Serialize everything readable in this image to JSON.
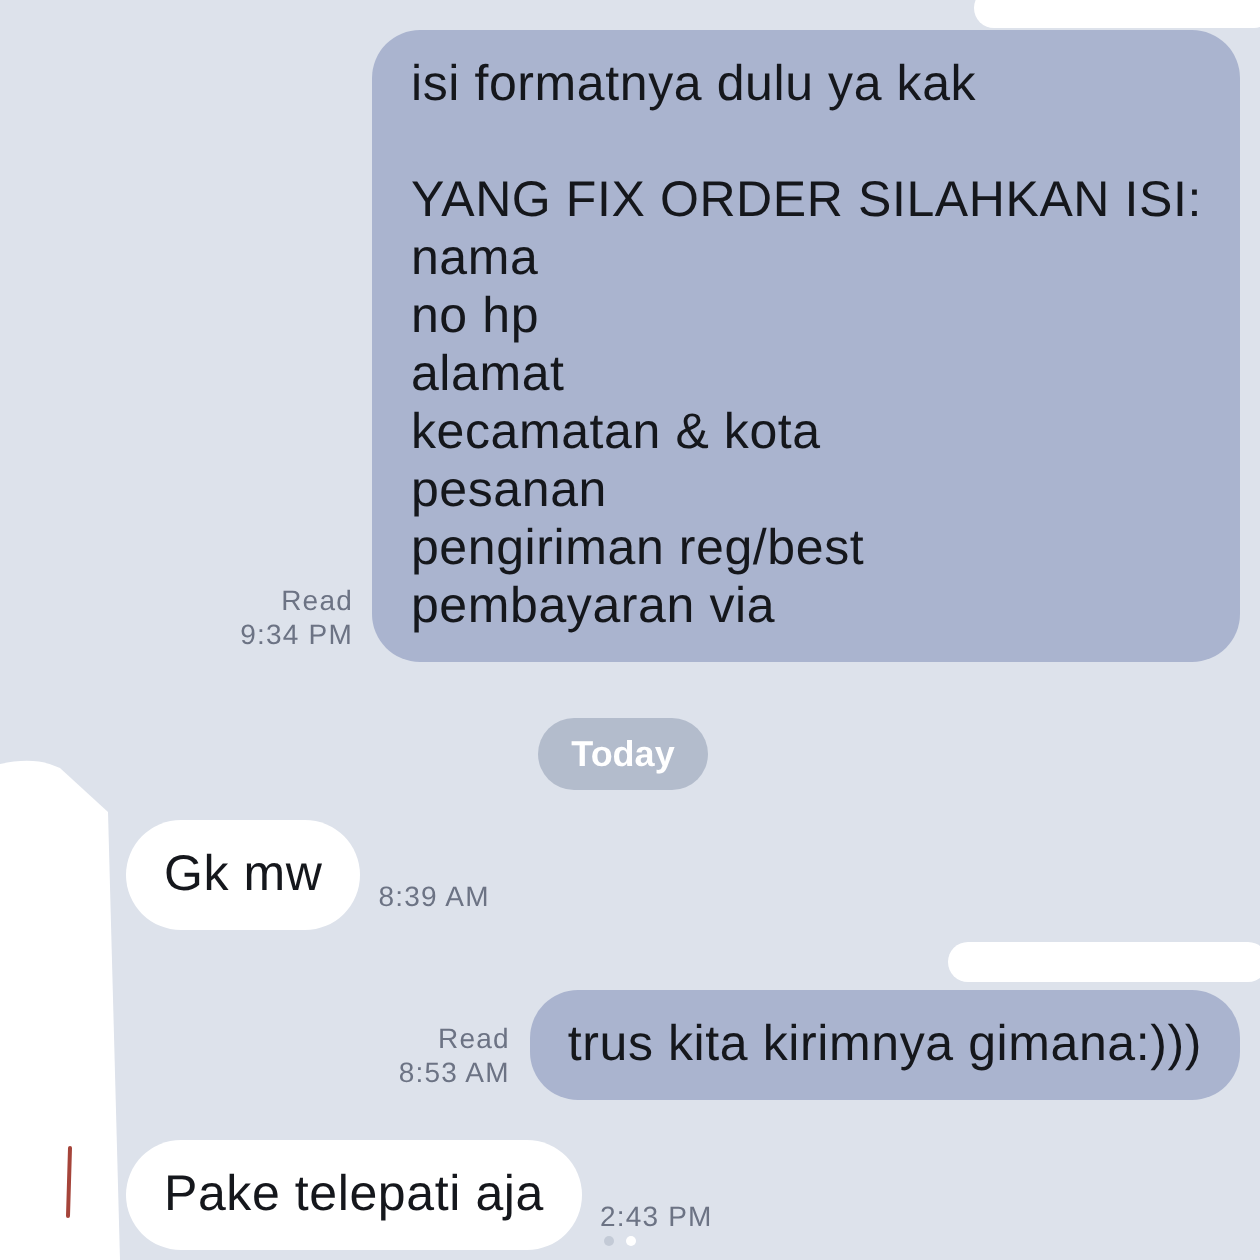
{
  "messages": [
    {
      "kind": "outgoing",
      "text": "isi formatnya dulu ya kak\n\nYANG FIX ORDER SILAHKAN ISI:\nnama\nno hp\nalamat\nkecamatan & kota\npesanan\npengiriman reg/best\npembayaran via",
      "read_label": "Read",
      "time": "9:34 PM"
    },
    {
      "kind": "date",
      "text": "Today"
    },
    {
      "kind": "incoming",
      "text": "Gk mw",
      "time": "8:39 AM"
    },
    {
      "kind": "outgoing",
      "text": "trus kita kirimnya gimana:)))",
      "read_label": "Read",
      "time": "8:53 AM"
    },
    {
      "kind": "incoming",
      "text": "Pake telepati aja",
      "time": "2:43 PM"
    }
  ],
  "page_indicator": [
    {
      "selected": false
    },
    {
      "selected": true
    }
  ]
}
